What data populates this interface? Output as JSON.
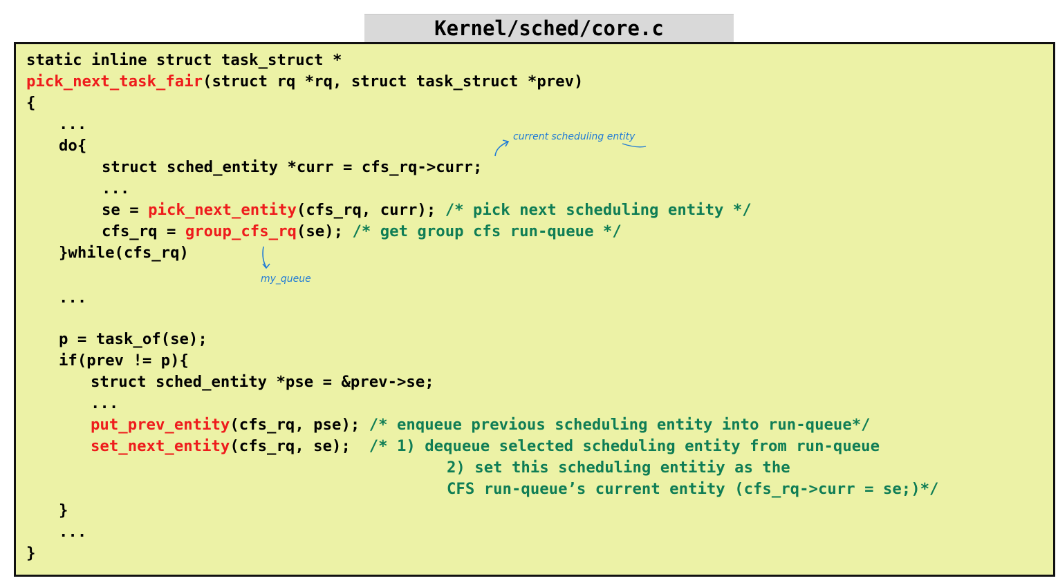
{
  "header": {
    "file_path": "Kernel/sched/core.c"
  },
  "code": {
    "l1": "static inline struct task_struct *",
    "l2_fn": "pick_next_task_fair",
    "l2_rest": "(struct rq *rq, struct task_struct *prev)",
    "l3": "{",
    "l4": "...",
    "l5": "do{",
    "l6": "struct sched_entity *curr = cfs_rq->curr;",
    "l7": "...",
    "l8_a": "se = ",
    "l8_fn": "pick_next_entity",
    "l8_b": "(cfs_rq, curr); ",
    "l8_c": "/* pick next scheduling entity */",
    "l9_a": "cfs_rq = ",
    "l9_fn": "group_cfs_rq",
    "l9_b": "(se); ",
    "l9_c": "/* get group cfs run-queue */",
    "l10": "}while(cfs_rq)",
    "l11": "...",
    "l12": "p = task_of(se);",
    "l13": "if(prev != p){",
    "l14": "struct sched_entity *pse = &prev->se;",
    "l15": "...",
    "l16_fn": "put_prev_entity",
    "l16_b": "(cfs_rq, pse); ",
    "l16_c": "/* enqueue previous scheduling entity into run-queue*/",
    "l17_fn": "set_next_entity",
    "l17_b": "(cfs_rq, se);  ",
    "l17_c": "/* 1) dequeue selected scheduling entity from run-queue",
    "l18_c": "2) set this scheduling entitiy as the",
    "l19_c": "CFS run-queue’s current entity (cfs_rq->curr = se;)*/",
    "l20": "}",
    "l21": "...",
    "l22": "}"
  },
  "annotations": {
    "curr_note": "current scheduling entity",
    "queue_note": "my_queue"
  },
  "colors": {
    "box_bg": "#ecf2a6",
    "function_red": "#ee1c1c",
    "comment_green": "#0f7d55",
    "handwriting_blue": "#1f7ad6"
  }
}
